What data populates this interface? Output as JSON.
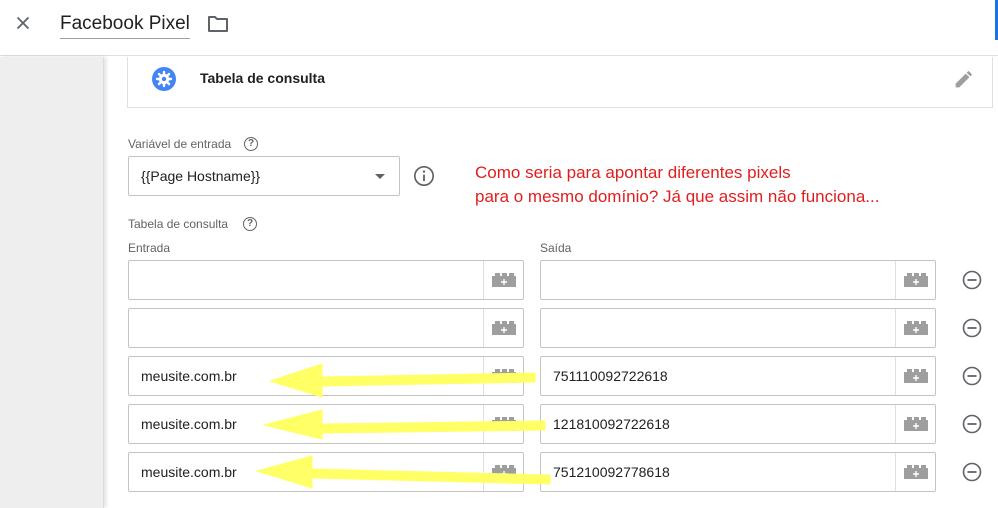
{
  "header": {
    "title": "Facebook Pixel"
  },
  "variable": {
    "type_label": "Tabela de consulta"
  },
  "input_variable": {
    "label": "Variável de entrada",
    "value": "{{Page Hostname}}"
  },
  "annotation": {
    "line1": "Como seria para apontar diferentes pixels",
    "line2": "para o mesmo domínio? Já que assim não funciona..."
  },
  "lookup_table": {
    "label": "Tabela de consulta",
    "col_input": "Entrada",
    "col_output": "Saída",
    "rows": [
      {
        "input": "",
        "output": ""
      },
      {
        "input": "",
        "output": ""
      },
      {
        "input": "meusite.com.br",
        "output": "751110092722618"
      },
      {
        "input": "meusite.com.br",
        "output": "121810092722618"
      },
      {
        "input": "meusite.com.br",
        "output": "751210092778618"
      }
    ]
  },
  "colors": {
    "accent": "#1a73e8",
    "annotation": "#e01e1e",
    "arrow": "#ffff66"
  },
  "icons": {
    "close": "close-icon",
    "folder": "folder-icon",
    "variable_type": "gear-icon",
    "edit": "pencil-icon",
    "help": "help-icon",
    "info": "info-icon",
    "insert_variable": "brick-icon",
    "remove_row": "minus-circle-icon"
  }
}
